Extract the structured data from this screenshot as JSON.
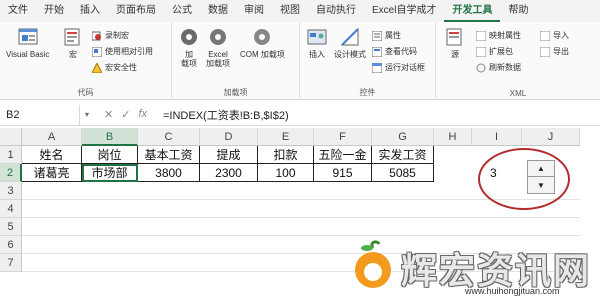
{
  "menu": {
    "tabs": [
      "文件",
      "开始",
      "插入",
      "页面布局",
      "公式",
      "数据",
      "审阅",
      "视图",
      "自动执行",
      "Excel自学成才",
      "开发工具",
      "帮助"
    ]
  },
  "ribbon": {
    "code": {
      "visual_basic": "Visual Basic",
      "macro": "宏",
      "record_macro": "录制宏",
      "relative_ref": "使用相对引用",
      "macro_security": "宏安全性",
      "group_label": "代码"
    },
    "addins": {
      "addins": "加\n载项",
      "excel_addins": "Excel\n加载项",
      "com_addins": "COM 加载项",
      "group_label": "加载项"
    },
    "controls": {
      "insert": "插入",
      "design_mode": "设计模式",
      "properties": "属性",
      "view_code": "查看代码",
      "run_dialog": "运行对话框",
      "group_label": "控件"
    },
    "xml": {
      "source": "源",
      "map_properties": "映射属性",
      "expansion_pack": "扩展包",
      "refresh_data": "刷新数据",
      "import": "导入",
      "export": "导出",
      "group_label": "XML"
    }
  },
  "formula_bar": {
    "name_box": "B2",
    "cancel": "✕",
    "enter": "✓",
    "fx": "fx",
    "formula": "=INDEX(工资表!B:B,$I$2)"
  },
  "grid": {
    "columns": [
      "A",
      "B",
      "C",
      "D",
      "E",
      "F",
      "G",
      "H",
      "I",
      "J"
    ],
    "rows": [
      "1",
      "2",
      "3",
      "4",
      "5",
      "6",
      "7"
    ],
    "header_row": [
      "姓名",
      "岗位",
      "基本工资",
      "提成",
      "扣款",
      "五险一金",
      "实发工资"
    ],
    "data_row": [
      "诸葛亮",
      "市场部",
      "3800",
      "2300",
      "100",
      "915",
      "5085"
    ],
    "i2_value": "3"
  },
  "spinner": {
    "up": "▲",
    "down": "▼"
  },
  "watermark": {
    "text": "辉宏资讯网",
    "url": "www.huihongjituan.com"
  },
  "colors": {
    "accent": "#217346",
    "highlight_oval": "#b32b2b"
  }
}
